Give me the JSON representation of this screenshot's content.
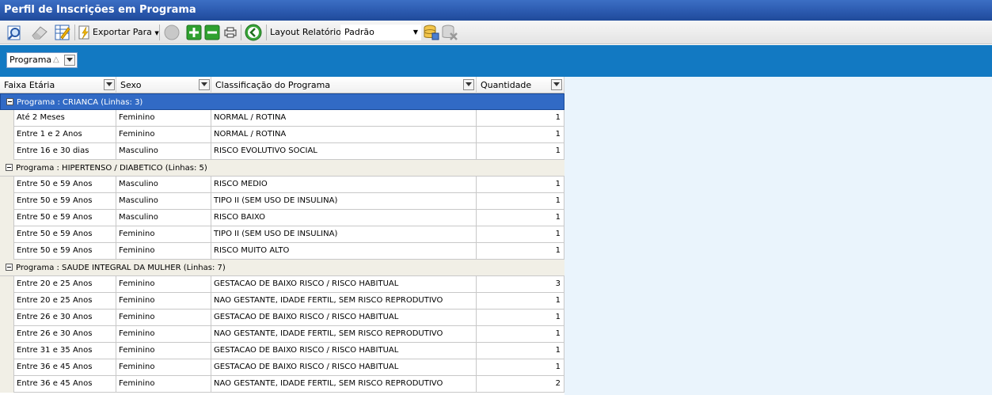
{
  "window": {
    "title": "Perfil de Inscrições em Programa"
  },
  "toolbar": {
    "export_label": "Exportar Para",
    "layout_label": "Layout Relatório",
    "layout_value": "Padrão",
    "icons": [
      "preview-icon",
      "eraser-icon",
      "edit-grid-icon",
      "export-icon",
      "circle-icon",
      "expand-all-icon",
      "collapse-all-icon",
      "print-icon",
      "back-icon",
      "database-icon",
      "database-delete-icon"
    ]
  },
  "grouping": {
    "chip_label": "Programa",
    "sort_glyph": "△"
  },
  "columns": [
    {
      "label": "Faixa Etária"
    },
    {
      "label": "Sexo"
    },
    {
      "label": "Classificação do Programa"
    },
    {
      "label": "Quantidade"
    }
  ],
  "groups": [
    {
      "label": "Programa : CRIANCA (Linhas: 3)",
      "selected": true,
      "rows": [
        [
          "Até 2 Meses",
          "Feminino",
          "NORMAL / ROTINA",
          "1"
        ],
        [
          "Entre 1 e 2 Anos",
          "Feminino",
          "NORMAL / ROTINA",
          "1"
        ],
        [
          "Entre 16 e 30 dias",
          "Masculino",
          "RISCO EVOLUTIVO SOCIAL",
          "1"
        ]
      ]
    },
    {
      "label": "Programa : HIPERTENSO / DIABETICO (Linhas: 5)",
      "selected": false,
      "rows": [
        [
          "Entre 50 e 59 Anos",
          "Masculino",
          "RISCO MEDIO",
          "1"
        ],
        [
          "Entre 50 e 59 Anos",
          "Masculino",
          "TIPO II (SEM USO DE INSULINA)",
          "1"
        ],
        [
          "Entre 50 e 59 Anos",
          "Masculino",
          "RISCO BAIXO",
          "1"
        ],
        [
          "Entre 50 e 59 Anos",
          "Feminino",
          "TIPO II (SEM USO DE INSULINA)",
          "1"
        ],
        [
          "Entre 50 e 59 Anos",
          "Feminino",
          "RISCO MUITO ALTO",
          "1"
        ]
      ]
    },
    {
      "label": "Programa : SAUDE INTEGRAL DA MULHER (Linhas: 7)",
      "selected": false,
      "rows": [
        [
          "Entre 20 e 25 Anos",
          "Feminino",
          "GESTACAO DE BAIXO RISCO / RISCO HABITUAL",
          "3"
        ],
        [
          "Entre 20 e 25 Anos",
          "Feminino",
          "NAO GESTANTE, IDADE FERTIL, SEM RISCO REPRODUTIVO",
          "1"
        ],
        [
          "Entre 26 e 30 Anos",
          "Feminino",
          "GESTACAO DE BAIXO RISCO / RISCO HABITUAL",
          "1"
        ],
        [
          "Entre 26 e 30 Anos",
          "Feminino",
          "NAO GESTANTE, IDADE FERTIL, SEM RISCO REPRODUTIVO",
          "1"
        ],
        [
          "Entre 31 e 35 Anos",
          "Feminino",
          "GESTACAO DE BAIXO RISCO / RISCO HABITUAL",
          "1"
        ],
        [
          "Entre 36 e 45 Anos",
          "Feminino",
          "GESTACAO DE BAIXO RISCO / RISCO HABITUAL",
          "1"
        ],
        [
          "Entre 36 e 45 Anos",
          "Feminino",
          "NAO GESTANTE, IDADE FERTIL, SEM RISCO REPRODUTIVO",
          "2"
        ]
      ]
    }
  ]
}
